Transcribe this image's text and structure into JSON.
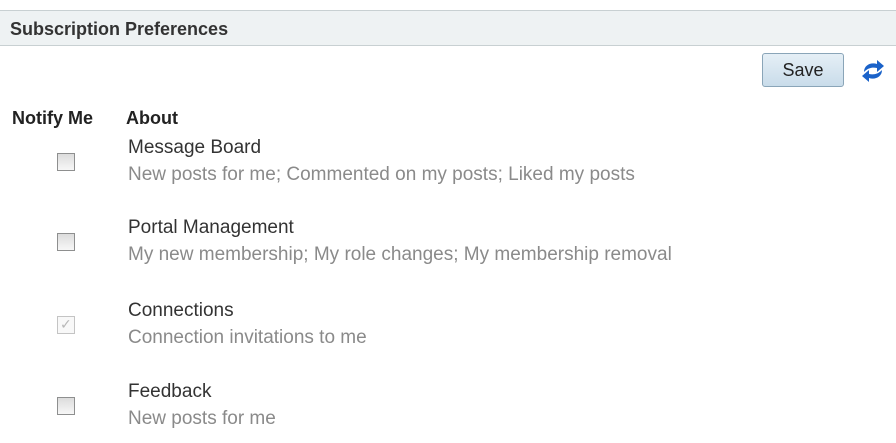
{
  "header": {
    "title": "Subscription Preferences"
  },
  "toolbar": {
    "save_label": "Save",
    "refresh_icon": "refresh-icon"
  },
  "columns": {
    "notify": "Notify Me",
    "about": "About"
  },
  "preferences": [
    {
      "title": "Message Board",
      "description": "New posts for me; Commented on my posts; Liked my posts",
      "checked": false,
      "disabled": false
    },
    {
      "title": "Portal Management",
      "description": "My new membership; My role changes; My membership removal",
      "checked": false,
      "disabled": false
    },
    {
      "title": "Connections",
      "description": "Connection invitations to me",
      "checked": true,
      "disabled": true
    },
    {
      "title": "Feedback",
      "description": "New posts for me",
      "checked": false,
      "disabled": false
    }
  ],
  "colors": {
    "header_bg": "#eef2f3",
    "refresh_blue": "#1a62c9",
    "description_gray": "#8a8a8a"
  }
}
